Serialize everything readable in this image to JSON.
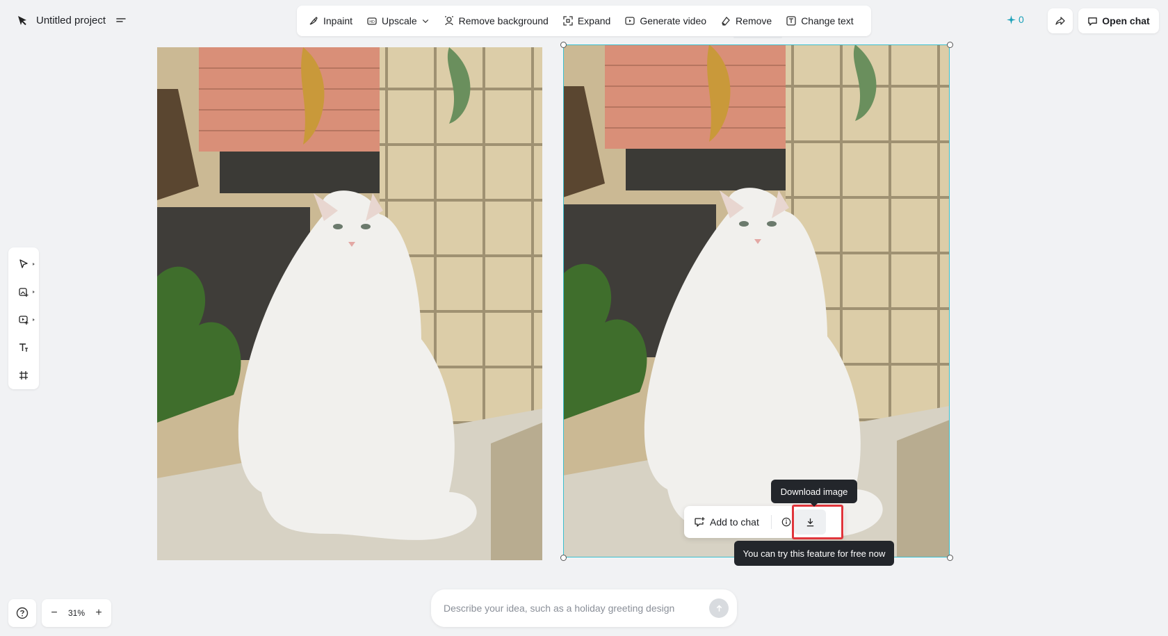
{
  "app": {
    "project_title": "Untitled project",
    "credits": "0",
    "open_chat_label": "Open chat",
    "accent_color": "#39c0cf"
  },
  "toolbar": {
    "items": [
      {
        "label": "Inpaint",
        "icon": "inpaint-icon"
      },
      {
        "label": "Upscale",
        "icon": "upscale-icon",
        "dropdown": true
      },
      {
        "label": "Remove background",
        "icon": "remove-background-icon"
      },
      {
        "label": "Expand",
        "icon": "expand-icon"
      },
      {
        "label": "Generate video",
        "icon": "video-icon"
      },
      {
        "label": "Remove",
        "icon": "eraser-icon"
      },
      {
        "label": "Change text",
        "icon": "text-box-icon"
      }
    ]
  },
  "left_tools": [
    "select-icon",
    "add-image-icon",
    "add-video-icon",
    "text-tool-icon",
    "frame-tool-icon"
  ],
  "image_bar": {
    "add_to_chat_label": "Add to chat",
    "download_tooltip": "Download image",
    "free_tooltip": "You can try this feature for free now"
  },
  "zoom": {
    "value": "31%",
    "minus": "−",
    "plus": "+"
  },
  "prompt": {
    "placeholder": "Describe your idea, such as a holiday greeting design"
  }
}
